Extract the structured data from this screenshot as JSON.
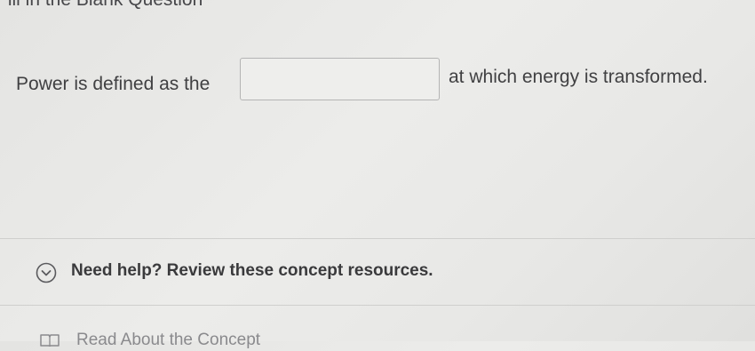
{
  "section": {
    "title": "Fill in the Blank Question"
  },
  "question": {
    "text_before": "Power is defined as the",
    "blank_value": "",
    "text_after": "at which energy is transformed."
  },
  "help": {
    "toggle_icon": "chevron-down-circle-icon",
    "label": "Need help? Review these concept resources."
  },
  "resources": [
    {
      "icon": "book-icon",
      "label": "Read About the Concept"
    }
  ],
  "colors": {
    "background": "#e8e8e6",
    "text": "#404042",
    "border": "#b4b4b4"
  }
}
